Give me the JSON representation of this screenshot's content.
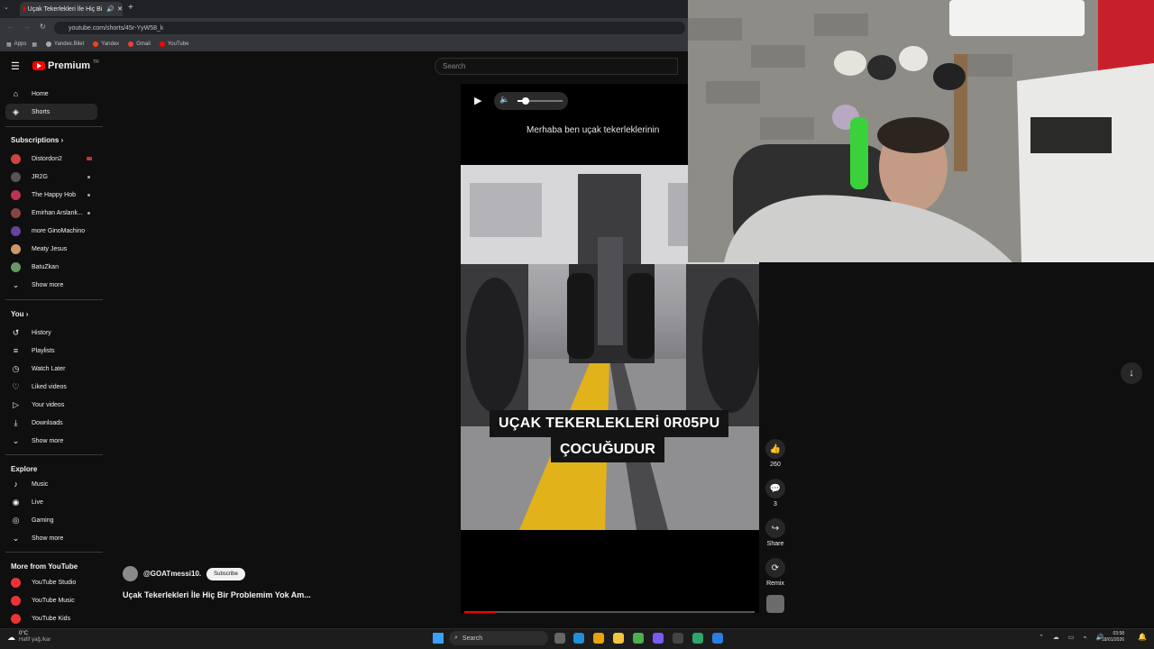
{
  "browser": {
    "tab_title": "Uçak Tekerlekleri İle Hiç Bi",
    "url": "youtube.com/shorts/45r-YyW58_k",
    "bookmarks": [
      "Apps",
      "Yandex.Bilet",
      "Yandex",
      "Gmail",
      "YouTube"
    ]
  },
  "header": {
    "logo_text": "Premium",
    "logo_badge": "TR",
    "search_placeholder": "Search"
  },
  "sidebar": {
    "main": [
      {
        "label": "Home",
        "icon": "home-icon"
      },
      {
        "label": "Shorts",
        "icon": "shorts-icon",
        "active": true
      }
    ],
    "subscriptions_heading": "Subscriptions",
    "subscriptions": [
      {
        "label": "Distordon2",
        "badge": "live"
      },
      {
        "label": "JR2G"
      },
      {
        "label": "The Happy Hob"
      },
      {
        "label": "Emirhan Arslank..."
      },
      {
        "label": "more GinoMachino"
      },
      {
        "label": "Meaty Jesus"
      },
      {
        "label": "BatuZkan"
      }
    ],
    "show_more": "Show more",
    "you_heading": "You",
    "you": [
      {
        "label": "History",
        "icon": "history-icon"
      },
      {
        "label": "Playlists",
        "icon": "playlists-icon"
      },
      {
        "label": "Watch Later",
        "icon": "watch-later-icon"
      },
      {
        "label": "Liked videos",
        "icon": "liked-icon"
      },
      {
        "label": "Your videos",
        "icon": "your-videos-icon"
      },
      {
        "label": "Downloads",
        "icon": "download-icon"
      }
    ],
    "explore_heading": "Explore",
    "explore": [
      {
        "label": "Music",
        "icon": "music-icon"
      },
      {
        "label": "Live",
        "icon": "live-icon"
      },
      {
        "label": "Gaming",
        "icon": "gaming-icon"
      }
    ],
    "more_heading": "More from YouTube",
    "more": [
      {
        "label": "YouTube Studio"
      },
      {
        "label": "YouTube Music"
      },
      {
        "label": "YouTube Kids"
      }
    ]
  },
  "player": {
    "caption_top": "Merhaba ben uçak tekerleklerinin",
    "overlay_line1": "UÇAK TEKERLEKLERİ 0R05PU",
    "overlay_line2": "ÇOCUĞUDUR",
    "progress": 0.11,
    "volume": 0.15
  },
  "actions": {
    "likes": "260",
    "comments": "3",
    "share": "Share",
    "remix": "Remix"
  },
  "channel": {
    "handle": "@GOATmessi10.",
    "subscribe": "Subscribe",
    "title": "Uçak Tekerlekleri İle Hiç Bir Problemim Yok Am..."
  },
  "taskbar": {
    "weather_temp": "0°C",
    "weather_desc": "Hafif yağ./kar",
    "search": "Search",
    "time": "03:58",
    "date": "18/01/2026"
  },
  "colors": {
    "accent": "#ff0000",
    "bg": "#0f0f0f"
  }
}
